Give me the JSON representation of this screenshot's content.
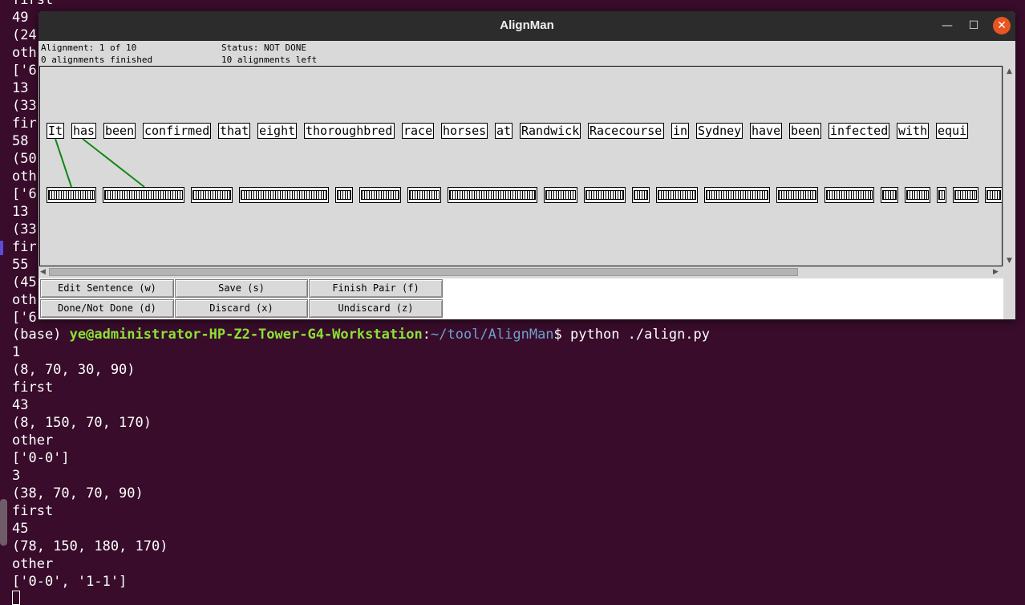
{
  "terminal": {
    "bg_lines": [
      "first",
      "49",
      "(24",
      "oth",
      "['6",
      "13",
      "(33",
      "fir",
      "58",
      "(50",
      "oth",
      "['6",
      "13",
      "(33",
      "fir",
      "55",
      "(45",
      "oth",
      "['6"
    ],
    "prompt": {
      "env": "(base) ",
      "userhost": "ye@administrator-HP-Z2-Tower-G4-Workstation",
      "sep": ":",
      "path": "~/tool/AlignMan",
      "command": "$ python ./align.py"
    },
    "output": [
      "1",
      "(8, 70, 30, 90)",
      "first",
      "43",
      "(8, 150, 70, 170)",
      "other",
      "['0-0']",
      "3",
      "(38, 70, 70, 90)",
      "first",
      "45",
      "(78, 150, 180, 170)",
      "other",
      "['0-0', '1-1']"
    ]
  },
  "window": {
    "title": "AlignMan",
    "controls": {
      "minimize": "—",
      "maximize": "☐",
      "close": "✕"
    }
  },
  "info": {
    "alignment": "Alignment: 1 of 10",
    "finished": "0 alignments finished",
    "status": "Status: NOT DONE",
    "left": "10 alignments left"
  },
  "source_words": [
    "It",
    "has",
    "been",
    "confirmed",
    "that",
    "eight",
    "thoroughbred",
    "race",
    "horses",
    "at",
    "Randwick",
    "Racecourse",
    "in",
    "Sydney",
    "have",
    "been",
    "infected",
    "with",
    "equi"
  ],
  "target_box_count": 22,
  "alignments": [
    "0-0",
    "1-1"
  ],
  "colors": {
    "alignment_line": "#118811",
    "terminal_bg": "#380c2a",
    "prompt_user": "#8ae234",
    "prompt_path": "#729fcf"
  },
  "buttons": {
    "edit_sentence": "Edit Sentence (w)",
    "save": "Save (s)",
    "finish_pair": "Finish Pair (f)",
    "done_not_done": "Done/Not Done (d)",
    "discard": "Discard (x)",
    "undiscard": "Undiscard (z)"
  }
}
